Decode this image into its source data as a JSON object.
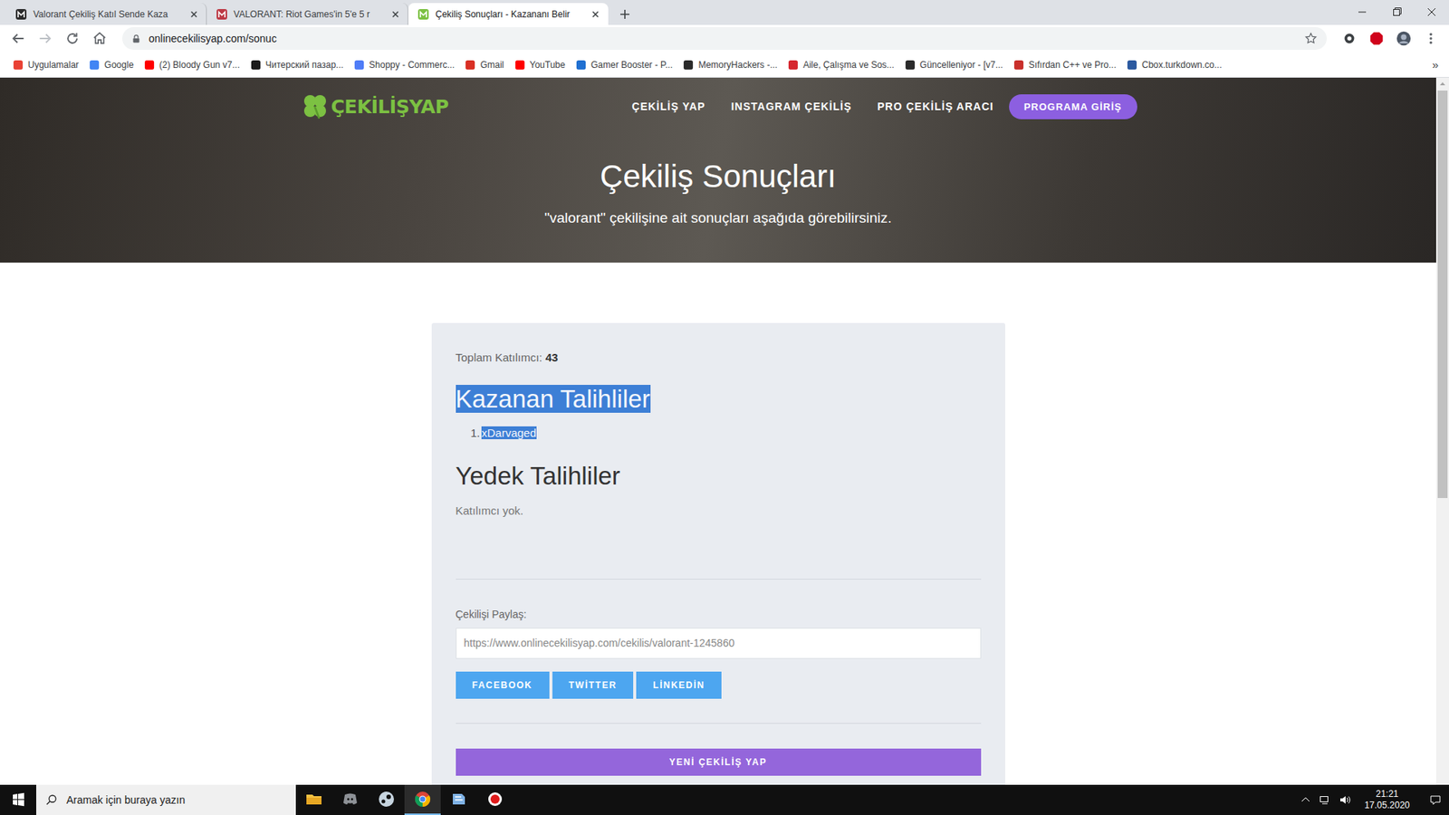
{
  "tabs": [
    {
      "label": "Valorant Çekiliş Katıl Sende Kaza",
      "selected": false,
      "color": "#2b2b2b"
    },
    {
      "label": "VALORANT: Riot Games'in 5'e 5 r",
      "selected": false,
      "color": "#bd3944"
    },
    {
      "label": "Çekiliş Sonuçları - Kazananı Belir",
      "selected": true,
      "color": "#7cc142"
    }
  ],
  "address": {
    "url": "onlinecekilisyap.com/sonuc"
  },
  "bookmarks": [
    {
      "label": "Uygulamalar",
      "color": "#e94235"
    },
    {
      "label": "Google",
      "color": "#4285f4"
    },
    {
      "label": "(2) Bloody Gun v7...",
      "color": "#ff0000"
    },
    {
      "label": "Читерский пазар...",
      "color": "#1a1a1a"
    },
    {
      "label": "Shoppy - Commerc...",
      "color": "#4f7cf7"
    },
    {
      "label": "Gmail",
      "color": "#d93025"
    },
    {
      "label": "YouTube",
      "color": "#ff0000"
    },
    {
      "label": "Gamer Booster - P...",
      "color": "#1f6fd1"
    },
    {
      "label": "MemoryHackers -...",
      "color": "#2b2b2b"
    },
    {
      "label": "Aile, Çalışma ve Sos...",
      "color": "#d6272f"
    },
    {
      "label": "Güncelleniyor - [v7...",
      "color": "#2b2b2b"
    },
    {
      "label": "Sıfırdan C++ ve Pro...",
      "color": "#c9302c"
    },
    {
      "label": "Cbox.turkdown.co...",
      "color": "#2c5aa0"
    }
  ],
  "bookmarks_more": "»",
  "site": {
    "logo": "ÇEKİLİŞYAP",
    "nav": [
      "ÇEKİLİŞ YAP",
      "INSTAGRAM ÇEKİLİŞ",
      "PRO ÇEKİLİŞ ARACI"
    ],
    "cta": "PROGRAMA GİRİŞ"
  },
  "hero": {
    "title": "Çekiliş Sonuçları",
    "subtitle": "\"valorant\" çekilişine ait sonuçları aşağıda görebilirsiniz."
  },
  "results": {
    "total_label": "Toplam Katılımcı:",
    "total": "43",
    "winners_title": "Kazanan Talihliler",
    "winners_title_highlighted": true,
    "winners": [
      {
        "rank": "1.",
        "name": "xDarvaged",
        "highlighted": true
      }
    ],
    "backup_title": "Yedek Talihliler",
    "backup_empty": "Katılımcı yok.",
    "share_label": "Çekilişi Paylaş:",
    "share_url": "https://www.onlinecekilisyap.com/cekilis/valorant-1245860",
    "share_buttons": [
      "FACEBOOK",
      "TWİTTER",
      "LİNKEDİN"
    ],
    "new_button": "YENİ ÇEKİLİŞ YAP"
  },
  "taskbar": {
    "search_placeholder": "Aramak için buraya yazın",
    "apps": [
      {
        "kind": "explorer",
        "active": false
      },
      {
        "kind": "discord",
        "active": false
      },
      {
        "kind": "steam",
        "active": false
      },
      {
        "kind": "chrome",
        "active": true
      },
      {
        "kind": "app",
        "active": false
      },
      {
        "kind": "recorder",
        "active": false
      }
    ],
    "time": "21:21",
    "date": "17.05.2020"
  }
}
